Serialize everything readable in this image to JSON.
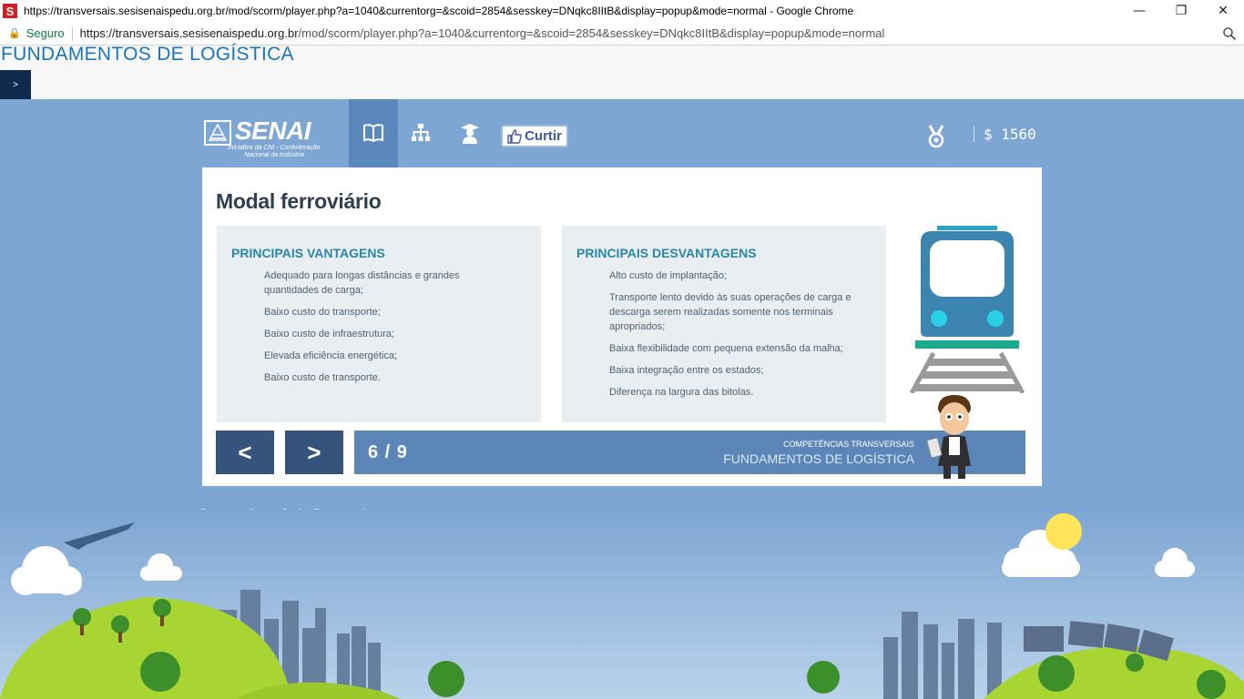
{
  "browser": {
    "window_title": "https://transversais.sesisenaispedu.org.br/mod/scorm/player.php?a=1040&currentorg=&scoid=2854&sesskey=DNqkc8IItB&display=popup&mode=normal - Google Chrome",
    "secure_label": "Seguro",
    "url_host": "https://transversais.sesisenaispedu.org.br",
    "url_path": "/mod/scorm/player.php?a=1040&currentorg=&scoid=2854&sesskey=DNqkc8IItB&display=popup&mode=normal",
    "favicon_letter": "S"
  },
  "lms": {
    "course_title": "FUNDAMENTOS DE LOGÍSTICA",
    "toggle_label": ">"
  },
  "app": {
    "logo_brand": "SENAI",
    "logo_subtitle": "Iniciativa da CNI - Confederação Nacional da Indústria",
    "like_label": "Curtir",
    "coins": "$ 1560",
    "icons": [
      "book-icon",
      "sitemap-icon",
      "graduate-icon",
      "medal-icon"
    ]
  },
  "content": {
    "title": "Modal ferroviário",
    "advantages": {
      "heading": "PRINCIPAIS VANTAGENS",
      "items": [
        "Adequado para longas distâncias e grandes quantidades de carga;",
        "Baixo custo do transporte;",
        "Baixo custo de infraestrutura;",
        "Elevada eficiência energética;",
        "Baixo custo de transporte."
      ]
    },
    "disadvantages": {
      "heading": "PRINCIPAIS DESVANTAGENS",
      "items": [
        "Alto custo de implantação;",
        "Transporte lento devido às suas operações de carga e descarga serem realizadas somente nos terminais apropriados;",
        "Baixa flexibilidade com pequena extensão da malha;",
        "Baixa integração entre os estados;",
        "Diferença na largura das bitolas."
      ]
    }
  },
  "navigation": {
    "prev_label": "<",
    "next_label": ">",
    "page_indicator": "6 / 9",
    "program_label": "COMPETÊNCIAS TRANSVERSAIS",
    "course_label": "FUNDAMENTOS DE LOGÍSTICA"
  },
  "footer": {
    "text": "Programa Competências Transversais."
  },
  "colors": {
    "background": "#7ea6d3",
    "accent_dark": "#34547b",
    "heading": "#2a86a8",
    "train_blue": "#3c85b0",
    "grass": "#a8d532"
  }
}
